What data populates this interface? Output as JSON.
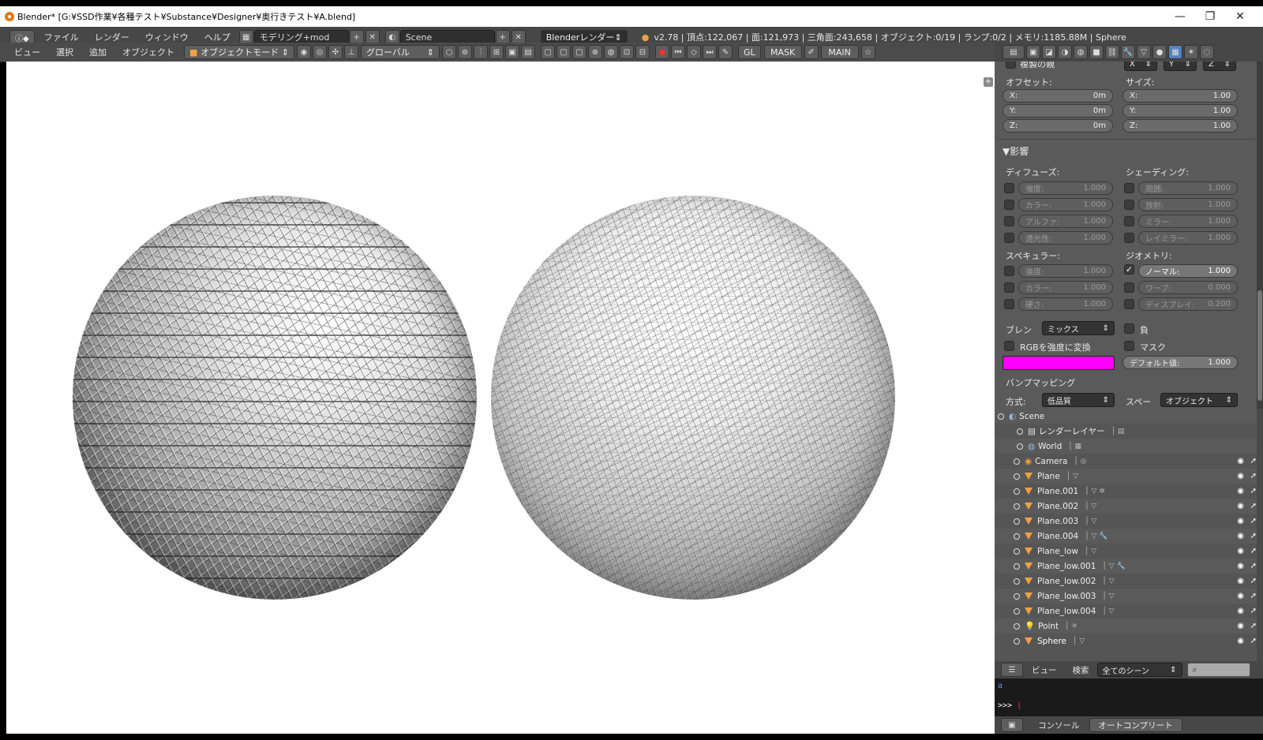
{
  "window": {
    "title": "Blender* [G:¥SSD作業¥各種テスト¥Substance¥Designer¥奥行きテスト¥A.blend]",
    "minimize": "—",
    "maximize": "❐",
    "close": "✕"
  },
  "header": {
    "menus": [
      "ファイル",
      "レンダー",
      "ウィンドウ",
      "ヘルプ"
    ],
    "layout": "モデリング+mod",
    "scene": "Scene",
    "engine": "Blenderレンダー",
    "stats": "v2.78 | 頂点:122,067 | 面:121,973 | 三角面:243,658 | オブジェクト:0/19 | ランプ:0/2 | メモリ:1185.88M | Sphere"
  },
  "view3d_header": {
    "menus": [
      "ビュー",
      "選択",
      "追加",
      "オブジェクト"
    ],
    "mode": "オブジェクトモード",
    "orientation": "グローバル",
    "gl_label": "GL",
    "mask_label": "MASK",
    "main_label": "MAIN"
  },
  "properties": {
    "copy_label": "複製の親",
    "xyz": [
      "X",
      "Y",
      "Z"
    ],
    "offset_label": "オフセット:",
    "size_label": "サイズ:",
    "offset": [
      {
        "axis": "X:",
        "val": "0m"
      },
      {
        "axis": "Y:",
        "val": "0m"
      },
      {
        "axis": "Z:",
        "val": "0m"
      }
    ],
    "size": [
      {
        "axis": "X:",
        "val": "1.00"
      },
      {
        "axis": "Y:",
        "val": "1.00"
      },
      {
        "axis": "Z:",
        "val": "1.00"
      }
    ],
    "influence_title": "▼影響",
    "diffuse_label": "ディフューズ:",
    "shading_label": "シェーディング:",
    "diffuse": [
      {
        "name": "強度:",
        "val": "1.000"
      },
      {
        "name": "カラー:",
        "val": "1.000"
      },
      {
        "name": "アルファ:",
        "val": "1.000"
      },
      {
        "name": "透光性:",
        "val": "1.000"
      }
    ],
    "shading": [
      {
        "name": "周囲:",
        "val": "1.000"
      },
      {
        "name": "放射:",
        "val": "1.000"
      },
      {
        "name": "ミラー:",
        "val": "1.000"
      },
      {
        "name": "レイミラー:",
        "val": "1.000"
      }
    ],
    "specular_label": "スペキュラー:",
    "geometry_label": "ジオメトリ:",
    "specular": [
      {
        "name": "強度:",
        "val": "1.000"
      },
      {
        "name": "カラー:",
        "val": "1.000"
      },
      {
        "name": "硬さ:",
        "val": "1.000"
      }
    ],
    "geometry": [
      {
        "name": "ノーマル:",
        "val": "1.000"
      },
      {
        "name": "ワープ:",
        "val": "0.000"
      },
      {
        "name": "ディスプレイ:",
        "val": "0.200"
      }
    ],
    "blend_label": "ブレン",
    "blend_value": "ミックス",
    "negative_label": "負",
    "rgb_to_intensity": "RGBを強度に変換",
    "mask_label": "マスク",
    "default_value_label": "デフォルト値:",
    "default_value": "1.000",
    "bump_label": "バンプマッピング",
    "method_label": "方式:",
    "method_value": "低品質",
    "space_label": "スペー",
    "space_value": "オブジェクト",
    "swatch_color": "#ff00ff"
  },
  "outliner": {
    "items": [
      {
        "name": "Scene",
        "kind": "scene"
      },
      {
        "name": "レンダーレイヤー",
        "kind": "layer"
      },
      {
        "name": "World",
        "kind": "world"
      },
      {
        "name": "Camera",
        "kind": "camera"
      },
      {
        "name": "Plane",
        "kind": "mesh"
      },
      {
        "name": "Plane.001",
        "kind": "mesh"
      },
      {
        "name": "Plane.002",
        "kind": "mesh"
      },
      {
        "name": "Plane.003",
        "kind": "mesh"
      },
      {
        "name": "Plane.004",
        "kind": "mesh"
      },
      {
        "name": "Plane_low",
        "kind": "mesh"
      },
      {
        "name": "Plane_low.001",
        "kind": "mesh"
      },
      {
        "name": "Plane_low.002",
        "kind": "mesh"
      },
      {
        "name": "Plane_low.003",
        "kind": "mesh"
      },
      {
        "name": "Plane_low.004",
        "kind": "mesh"
      },
      {
        "name": "Point",
        "kind": "lamp"
      },
      {
        "name": "Sphere",
        "kind": "mesh"
      }
    ],
    "view_menu": "ビュー",
    "search_menu": "検索",
    "filter": "全てのシーン"
  },
  "console": {
    "line1": "a",
    "prompt": ">>> ",
    "console_button": "コンソール",
    "autocomplete_button": "オートコンプリート"
  }
}
